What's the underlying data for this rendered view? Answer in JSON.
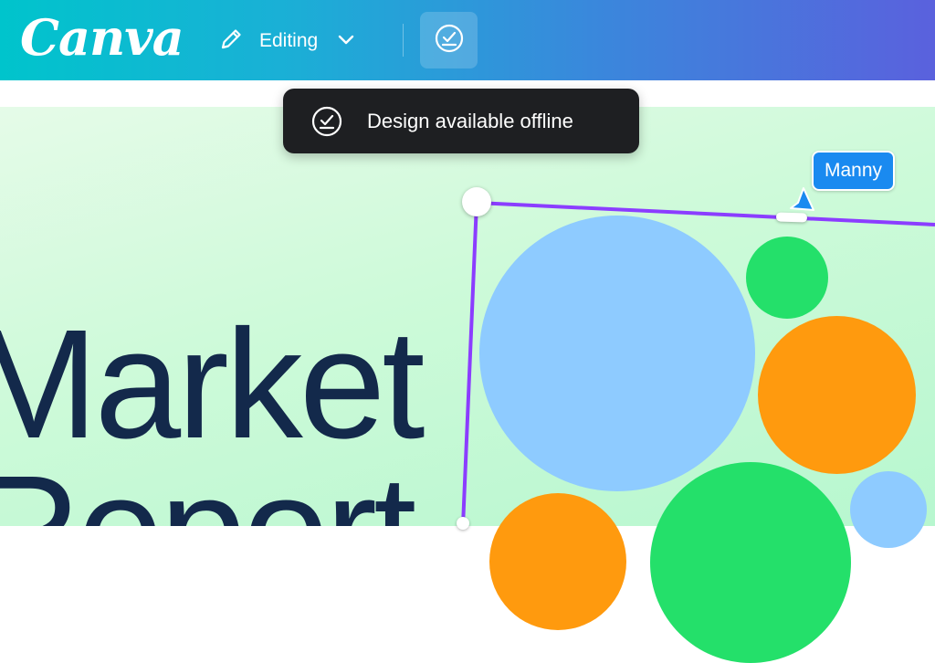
{
  "app": {
    "logo": "Canva"
  },
  "topbar": {
    "mode_label": "Editing",
    "icons": {
      "edit": "pencil-icon",
      "mode_dropdown": "chevron-down-icon",
      "offline": "offline-check-icon"
    }
  },
  "toast": {
    "message": "Design available offline",
    "icon": "offline-check-icon"
  },
  "design": {
    "title_line1": "Market",
    "title_line2": "Report",
    "colors": {
      "title": "#13294b",
      "blue": "#8ecbff",
      "green": "#24e06a",
      "orange": "#ff9a0e",
      "selection": "#8b3dff"
    }
  },
  "collaborator": {
    "name": "Manny",
    "color": "#1a8af0"
  }
}
